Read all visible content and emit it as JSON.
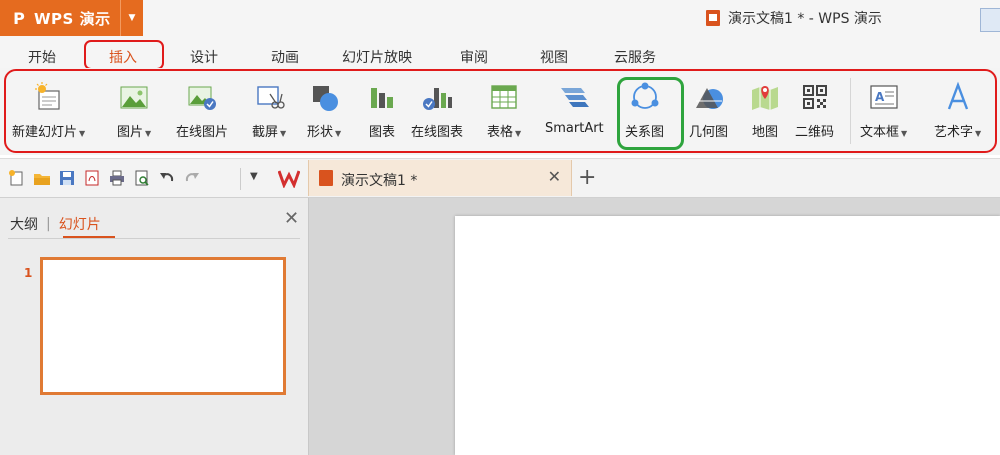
{
  "app": {
    "name": "WPS 演示",
    "logo_glyph": "P",
    "dropdown_glyph": "▼"
  },
  "window": {
    "title": "演示文稿1 * - WPS 演示"
  },
  "tabs": [
    {
      "label": "开始",
      "active": false
    },
    {
      "label": "插入",
      "active": true
    },
    {
      "label": "设计",
      "active": false
    },
    {
      "label": "动画",
      "active": false
    },
    {
      "label": "幻灯片放映",
      "active": false
    },
    {
      "label": "审阅",
      "active": false
    },
    {
      "label": "视图",
      "active": false
    },
    {
      "label": "云服务",
      "active": false
    }
  ],
  "ribbon": {
    "new_slide": {
      "label": "新建幻灯片",
      "dropdown": true
    },
    "picture": {
      "label": "图片",
      "dropdown": true
    },
    "online_picture": {
      "label": "在线图片"
    },
    "screenshot": {
      "label": "截屏",
      "dropdown": true
    },
    "shape": {
      "label": "形状",
      "dropdown": true
    },
    "chart": {
      "label": "图表"
    },
    "online_chart": {
      "label": "在线图表"
    },
    "table": {
      "label": "表格",
      "dropdown": true
    },
    "smartart": {
      "label": "SmartArt"
    },
    "relation": {
      "label": "关系图"
    },
    "geometry": {
      "label": "几何图"
    },
    "map": {
      "label": "地图"
    },
    "qrcode": {
      "label": "二维码"
    },
    "textbox": {
      "label": "文本框",
      "dropdown": true
    },
    "wordart": {
      "label": "艺术字",
      "dropdown": true
    },
    "dropdown_glyph": "▼"
  },
  "quick_access": {
    "more_glyph": "▼"
  },
  "document_tab": {
    "label": "演示文稿1 *",
    "close_glyph": "✕",
    "new_tab_glyph": "+"
  },
  "left_pane": {
    "outline_tab": "大纲",
    "separator": "|",
    "slides_tab": "幻灯片",
    "close_glyph": "✕",
    "slide_number": "1"
  },
  "colors": {
    "accent": "#d9531e",
    "app_button": "#e56b1f",
    "highlight_red": "#e01b1b",
    "highlight_green": "#2ea43d"
  }
}
